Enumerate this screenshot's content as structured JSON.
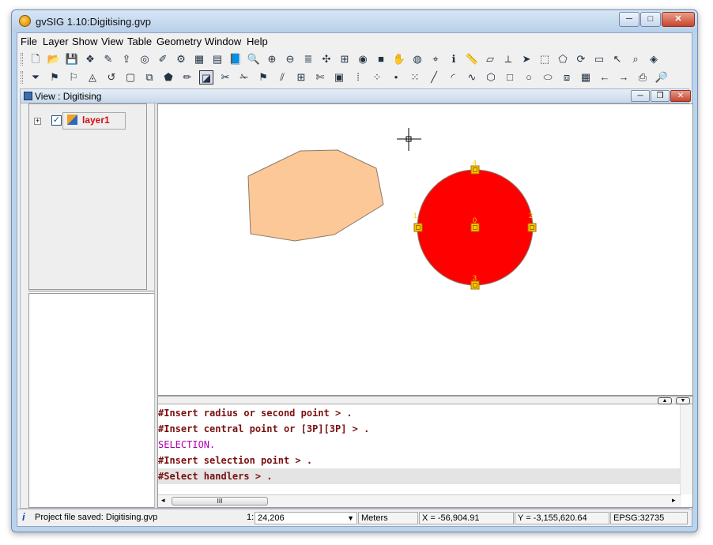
{
  "window": {
    "title": "gvSIG 1.10:Digitising.gvp",
    "controls": [
      "─",
      "□",
      "✕"
    ]
  },
  "menu": [
    "File",
    "Layer",
    "Show",
    "View",
    "Table",
    "Geometry",
    "Window",
    "Help"
  ],
  "view": {
    "title": "View : Digitising",
    "toc": {
      "layers": [
        {
          "name": "layer1",
          "checked": true
        }
      ]
    }
  },
  "map": {
    "polygon_color": "#fdc897",
    "circle_color": "#ff0000",
    "handler_color": "#ffc800",
    "handlers": [
      "0",
      "1",
      "2",
      "3",
      "4"
    ]
  },
  "console": {
    "lines": [
      {
        "text": "#Insert radius or second point > .",
        "type": "cmd"
      },
      {
        "text": "#Insert central point or [3P][3P] > .",
        "type": "cmd"
      },
      {
        "text": "SELECTION.",
        "type": "sel"
      },
      {
        "text": "#Insert selection point > .",
        "type": "cmd"
      },
      {
        "text": "#Select handlers > .",
        "type": "cmd"
      }
    ],
    "scroll_label": "III"
  },
  "status": {
    "message": "Project file saved: Digitising.gvp",
    "scale_prefix": "1:",
    "scale": "24,206",
    "units": "Meters",
    "x": "X = -56,904.91",
    "y": "Y = -3,155,620.64",
    "epsg": "EPSG:32735"
  },
  "toolbar1_icons": [
    "new-icon",
    "open-icon",
    "save-icon",
    "layers-icon",
    "paint-icon",
    "export-icon",
    "target-icon",
    "edit-icon",
    "gear-icon",
    "raster-icon",
    "table-icon",
    "book-icon",
    "zoom-in-icon",
    "zoom-plus-icon",
    "zoom-minus-icon",
    "stack-icon",
    "full-extent-icon",
    "zoom-layer-icon",
    "eye-icon",
    "color-icon",
    "pan-icon",
    "locator-icon",
    "info-point-icon",
    "info-icon",
    "measure-icon",
    "area-icon",
    "ruler-icon",
    "select-icon",
    "select-rect-icon",
    "select-poly-icon",
    "refresh-icon",
    "panel-icon",
    "cursor-icon",
    "select-zoom-icon",
    "center-icon"
  ],
  "toolbar2_icons": [
    "filter-icon",
    "geo1-icon",
    "geo2-icon",
    "geo3-icon",
    "undo-icon",
    "window-icon",
    "mirror-icon",
    "polygon-edit-icon",
    "pencil-icon",
    "select-handler-icon",
    "lasso-icon",
    "cut-icon",
    "flag-icon",
    "split-icon",
    "grid-icon",
    "scissors-icon",
    "palette-icon",
    "dotted-icon",
    "scatter-icon",
    "point-icon",
    "multipoint-icon",
    "line-icon",
    "arc-icon",
    "polyline-icon",
    "polygon-icon",
    "rectangle-icon",
    "circle-icon",
    "ellipse-icon",
    "autocomplete-icon",
    "table-grid-icon",
    "prev-icon",
    "next-icon",
    "print-icon",
    "find-icon"
  ]
}
